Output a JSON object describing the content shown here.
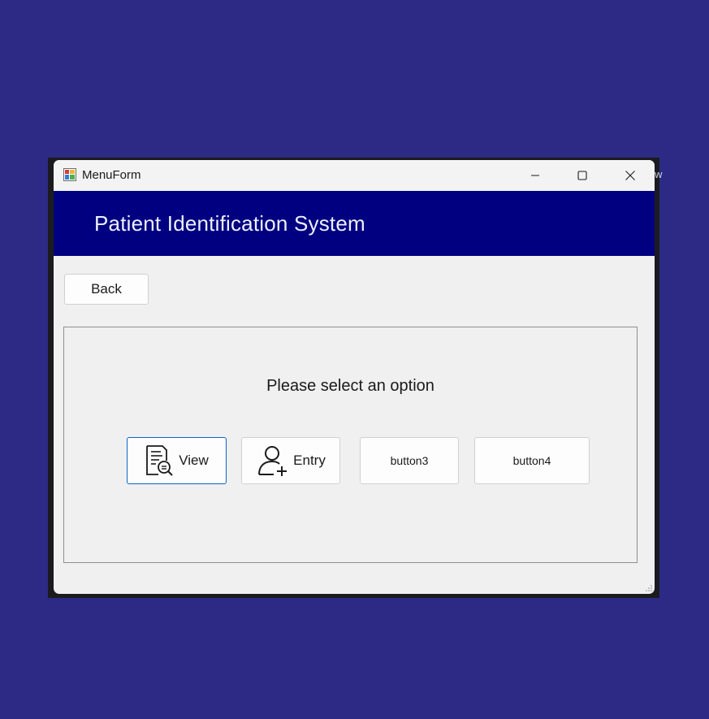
{
  "window": {
    "title": "MenuForm",
    "icon": "winforms-app-icon",
    "controls": {
      "minimize": "minimize-icon",
      "maximize": "maximize-icon",
      "close": "close-icon"
    }
  },
  "header": {
    "title": "Patient Identification System",
    "background": "#000080"
  },
  "toolbar": {
    "back_label": "Back"
  },
  "panel": {
    "prompt": "Please select an option",
    "buttons": [
      {
        "label": "View",
        "icon": "document-search-icon",
        "focused": true
      },
      {
        "label": "Entry",
        "icon": "add-user-icon",
        "focused": false
      },
      {
        "label": "button3",
        "icon": "",
        "focused": false
      },
      {
        "label": "button4",
        "icon": "",
        "focused": false
      }
    ]
  },
  "desktop": {
    "background": "#2c2a85",
    "ghost_text": "w"
  }
}
